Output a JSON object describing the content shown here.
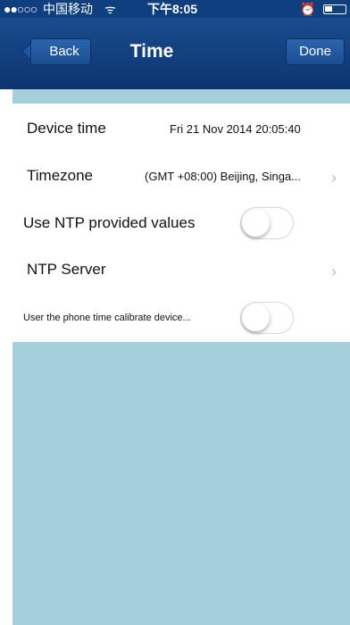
{
  "status_bar": {
    "signal": "●●○○○",
    "carrier": "中国移动",
    "wifi": "ᯤ",
    "time": "下午8:05",
    "alarm": "⏰"
  },
  "nav": {
    "back_label": "Back",
    "title": "Time",
    "done_label": "Done"
  },
  "settings": {
    "device_time_label": "Device time",
    "device_time_value": "Fri 21 Nov 2014  20:05:40",
    "timezone_label": "Timezone",
    "timezone_value": "(GMT +08:00) Beijing, Singa...",
    "ntp_values_label": "Use NTP provided values",
    "ntp_values_on": false,
    "ntp_server_label": "NTP Server",
    "phone_calibrate_label": "User the phone time calibrate device...",
    "phone_calibrate_on": false,
    "chevron": "›"
  },
  "colors": {
    "nav_bar": "#0f3f7e",
    "background": "#a6cfdc"
  }
}
